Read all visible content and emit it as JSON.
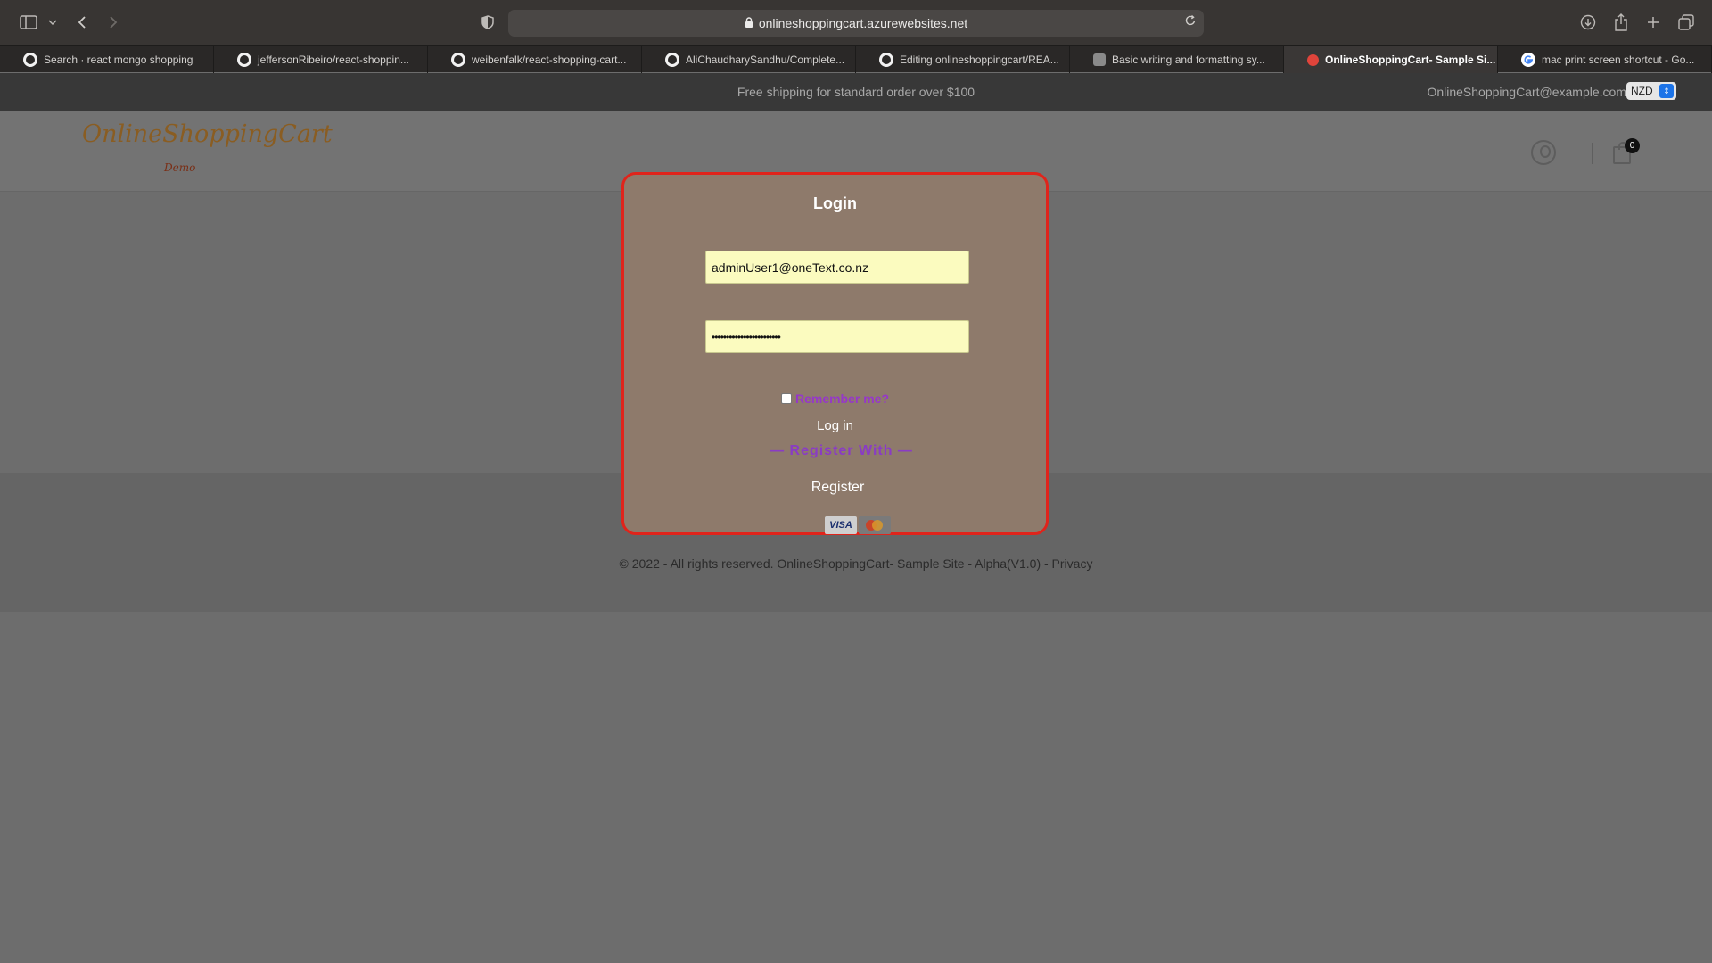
{
  "browser": {
    "url": "onlineshoppingcart.azurewebsites.net",
    "tabs": [
      {
        "title": "Search · react mongo shopping",
        "icon": "github-icon",
        "active": false
      },
      {
        "title": "jeffersonRibeiro/react-shoppin...",
        "icon": "github-icon",
        "active": false
      },
      {
        "title": "weibenfalk/react-shopping-cart...",
        "icon": "github-icon",
        "active": false
      },
      {
        "title": "AliChaudharySandhu/Complete...",
        "icon": "github-icon",
        "active": false
      },
      {
        "title": "Editing onlineshoppingcart/REA...",
        "icon": "github-icon",
        "active": false
      },
      {
        "title": "Basic writing and formatting sy...",
        "icon": "generic-site-icon",
        "active": false
      },
      {
        "title": "OnlineShoppingCart- Sample Si...",
        "icon": "red-dot-icon",
        "active": true
      },
      {
        "title": "mac print screen shortcut - Go...",
        "icon": "google-icon",
        "active": false
      }
    ]
  },
  "site": {
    "promo": "Free shipping for standard order over $100",
    "email": "OnlineShoppingCart@example.com",
    "currency": "NZD",
    "logo_main": "OnlineShoppingCart",
    "logo_sub": "Demo",
    "cart_count": "0",
    "footer": "© 2022 - All rights reserved. OnlineShoppingCart- Sample Site - Alpha(V1.0) - Privacy"
  },
  "login": {
    "title": "Login",
    "email_value": "adminUser1@oneText.co.nz",
    "password_value": "••••••••••••••••••••••••",
    "remember_label": "Remember me?",
    "remember_checked": false,
    "login_label": "Log in",
    "register_with_label": "— Register With —",
    "register_label": "Register",
    "payment_cards": [
      "VISA",
      "Mastercard"
    ]
  },
  "colors": {
    "modal_border": "#e0241b",
    "accent_purple": "#9637c9",
    "input_bg": "#fbfbbf"
  }
}
